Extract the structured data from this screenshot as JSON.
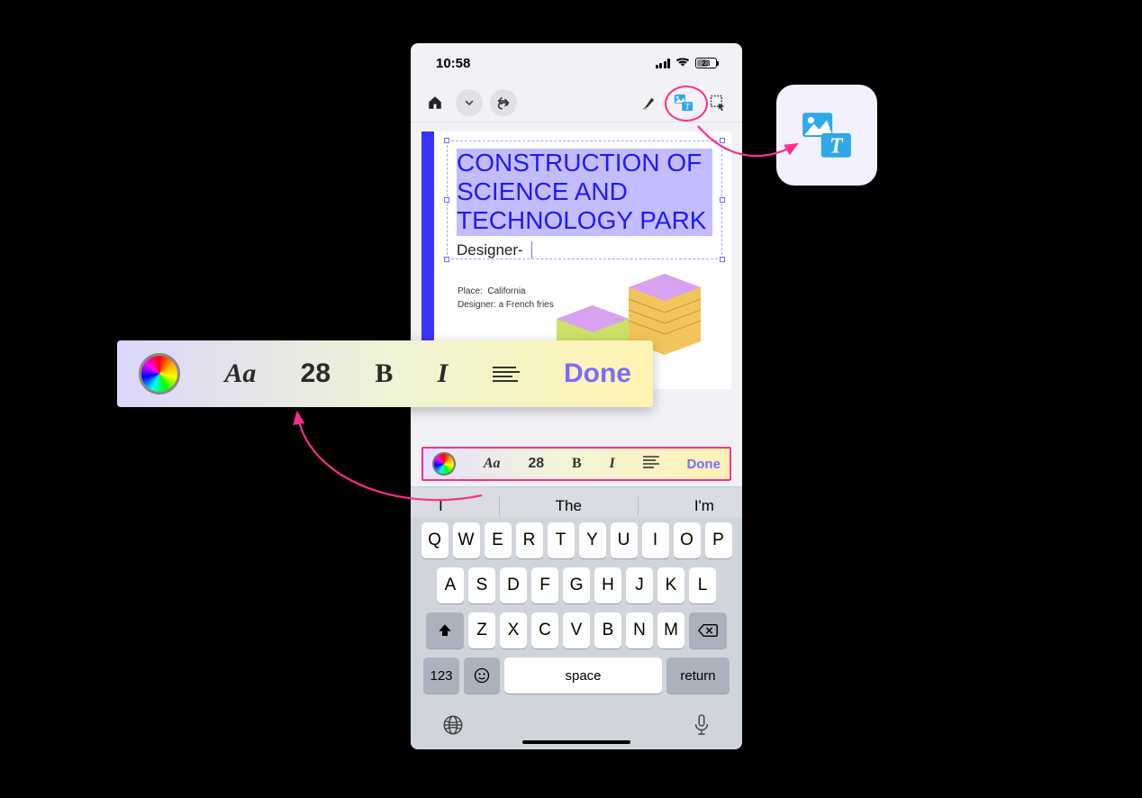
{
  "status": {
    "time": "10:58",
    "battery": "23"
  },
  "toolbar": {
    "icons": [
      "home",
      "chevron-down",
      "undo",
      "highlighter",
      "insert-object",
      "lasso-select"
    ]
  },
  "document": {
    "title": "CONSTRUCTION OF SCIENCE AND TECHNOLOGY PARK",
    "subtitle": "Designer- ",
    "meta_place_label": "Place:",
    "meta_place_value": "California",
    "meta_designer_label": "Designer:",
    "meta_designer_value": "a French fries"
  },
  "format_bar": {
    "font_label": "Aa",
    "size": "28",
    "bold": "B",
    "italic": "I",
    "done": "Done"
  },
  "suggestions": [
    "I",
    "The",
    "I'm"
  ],
  "keyboard": {
    "row1": [
      "Q",
      "W",
      "E",
      "R",
      "T",
      "Y",
      "U",
      "I",
      "O",
      "P"
    ],
    "row2": [
      "A",
      "S",
      "D",
      "F",
      "G",
      "H",
      "J",
      "K",
      "L"
    ],
    "row3": [
      "Z",
      "X",
      "C",
      "V",
      "B",
      "N",
      "M"
    ],
    "numbers": "123",
    "space": "space",
    "return": "return"
  }
}
